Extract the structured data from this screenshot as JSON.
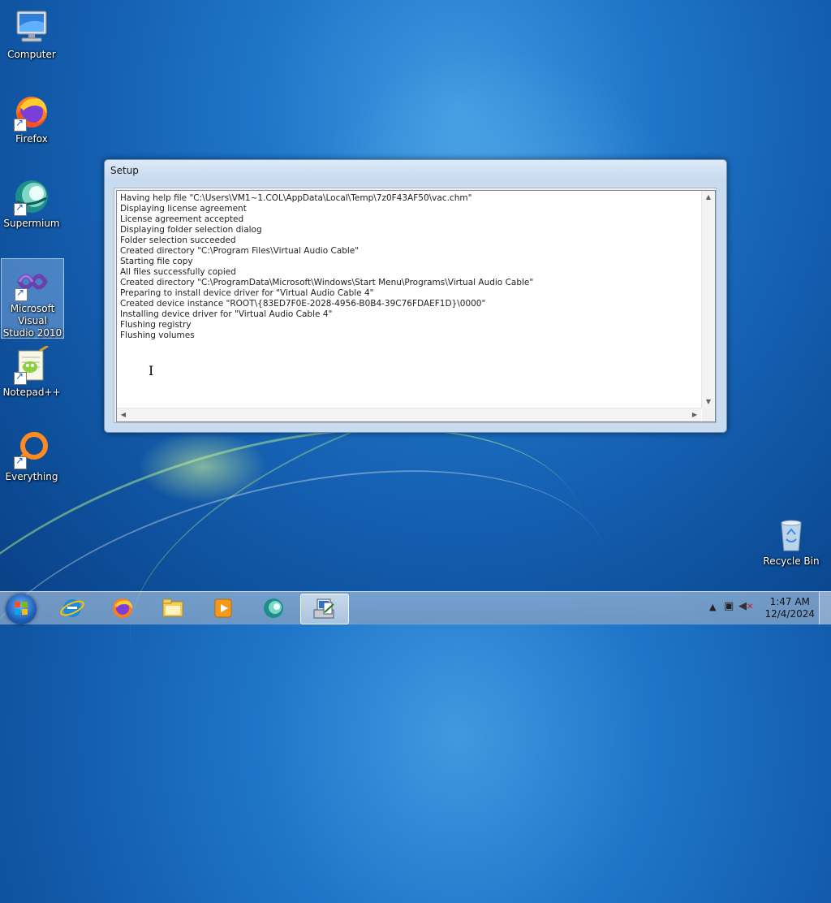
{
  "desktop": {
    "icons": [
      {
        "label": "Computer",
        "icon": "computer-icon"
      },
      {
        "label": "Firefox",
        "icon": "firefox-icon"
      },
      {
        "label": "Supermium",
        "icon": "supermium-icon"
      },
      {
        "label": "Microsoft Visual Studio 2010",
        "icon": "visual-studio-icon"
      },
      {
        "label": "Notepad++",
        "icon": "notepadpp-icon"
      },
      {
        "label": "Everything",
        "icon": "everything-icon"
      },
      {
        "label": "Recycle Bin",
        "icon": "recycle-bin-icon"
      }
    ]
  },
  "window": {
    "title": "Setup",
    "log": [
      "Having help file \"C:\\Users\\VM1~1.COL\\AppData\\Local\\Temp\\7z0F43AF50\\vac.chm\"",
      "Displaying license agreement",
      "License agreement accepted",
      "Displaying folder selection dialog",
      "Folder selection succeeded",
      "Created directory \"C:\\Program Files\\Virtual Audio Cable\"",
      "Starting file copy",
      "All files successfully copied",
      "Created directory \"C:\\ProgramData\\Microsoft\\Windows\\Start Menu\\Programs\\Virtual Audio Cable\"",
      "Preparing to install device driver for \"Virtual Audio Cable 4\"",
      "Created device instance \"ROOT\\{83ED7F0E-2028-4956-B0B4-39C76FDAEF1D}\\0000\"",
      "Installing device driver for \"Virtual Audio Cable 4\"",
      "Flushing registry",
      "Flushing volumes"
    ]
  },
  "taskbar": {
    "apps": [
      "internet-explorer-icon",
      "firefox-icon",
      "file-explorer-icon",
      "media-player-icon",
      "supermium-icon",
      "setup-app-icon"
    ],
    "clock": {
      "time": "1:47 AM",
      "date": "12/4/2024"
    }
  },
  "colors": {
    "accent": "#1f76c9",
    "window_frame": "#c9dbef"
  }
}
